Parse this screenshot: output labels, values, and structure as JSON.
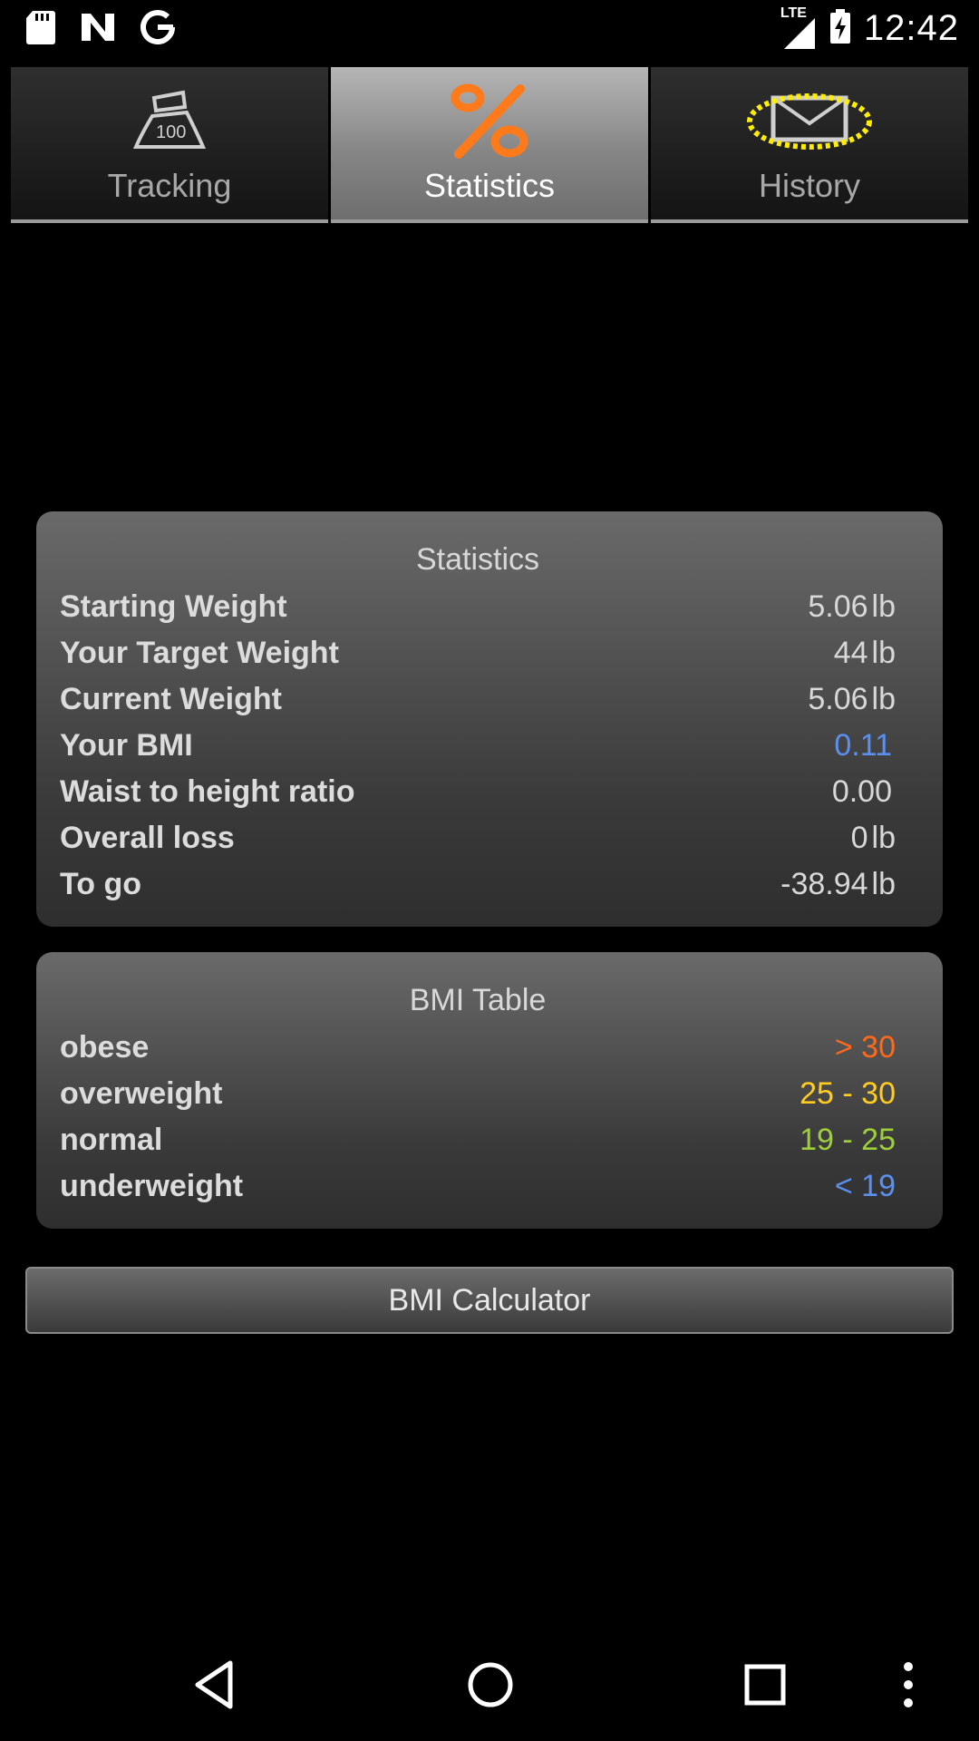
{
  "status_bar": {
    "time": "12:42",
    "network": "LTE",
    "icons": [
      "sd-card-icon",
      "n-notification-icon",
      "google-icon",
      "signal-icon",
      "battery-charging-icon"
    ]
  },
  "tabs": [
    {
      "label": "Tracking",
      "icon": "scale-weight-icon",
      "selected": false
    },
    {
      "label": "Statistics",
      "icon": "percent-icon",
      "selected": true
    },
    {
      "label": "History",
      "icon": "envelope-icon",
      "selected": false
    }
  ],
  "statistics": {
    "title": "Statistics",
    "rows": [
      {
        "label": "Starting Weight",
        "value": "5.06",
        "unit": "lb"
      },
      {
        "label": "Your Target Weight",
        "value": "44",
        "unit": "lb"
      },
      {
        "label": "Current Weight",
        "value": "5.06",
        "unit": "lb"
      },
      {
        "label": "Your BMI",
        "value": "0.11",
        "unit": ""
      },
      {
        "label": "Waist to height ratio",
        "value": "0.00",
        "unit": ""
      },
      {
        "label": "Overall loss",
        "value": "0",
        "unit": "lb"
      },
      {
        "label": "To go",
        "value": "-38.94",
        "unit": "lb"
      }
    ],
    "bmi_value_color": "#5b8ff0"
  },
  "bmi_table": {
    "title": "BMI Table",
    "rows": [
      {
        "label": "obese",
        "range": "> 30",
        "color": "#ff6a1a"
      },
      {
        "label": "overweight",
        "range": "25 - 30",
        "color": "#ffcc22"
      },
      {
        "label": "normal",
        "range": "19 - 25",
        "color": "#9ecf3a"
      },
      {
        "label": "underweight",
        "range": "< 19",
        "color": "#5b8ff0"
      }
    ]
  },
  "calculator_button": {
    "label": "BMI Calculator"
  },
  "nav_bar": {
    "icons": [
      "back-icon",
      "home-icon",
      "recents-icon",
      "more-icon"
    ]
  },
  "colors": {
    "accent": "#ff7a1a",
    "highlight_ring": "#ffee00"
  }
}
